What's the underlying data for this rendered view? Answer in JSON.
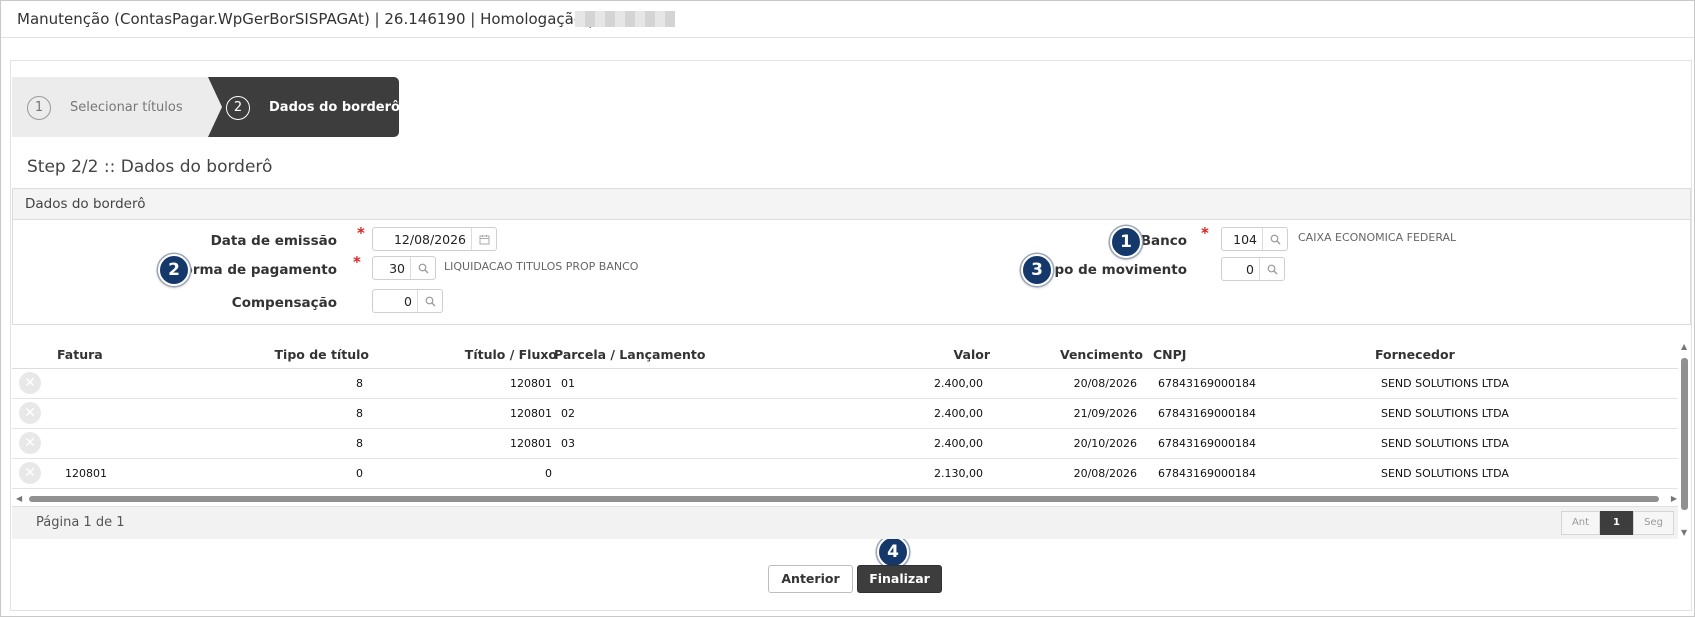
{
  "window": {
    "title": "Manutenção (ContasPagar.WpGerBorSISPAGAt) | 26.146190 | Homologação |"
  },
  "wizard": {
    "steps": [
      {
        "number": "1",
        "label": "Selecionar títulos"
      },
      {
        "number": "2",
        "label": "Dados do borderô"
      }
    ]
  },
  "page": {
    "heading": "Step 2/2 :: Dados do borderô"
  },
  "form": {
    "section_title": "Dados do borderô",
    "required_mark": "*",
    "data_emissao": {
      "label": "Data de emissão",
      "value": "12/08/2026",
      "icon": "calendar-icon"
    },
    "forma_pagamento": {
      "label": "Forma de pagamento",
      "value": "30",
      "description": "LIQUIDACAO TITULOS PROP BANCO",
      "icon": "search-icon"
    },
    "compensacao": {
      "label": "Compensação",
      "value": "0",
      "icon": "search-icon"
    },
    "banco": {
      "label": "Banco",
      "value": "104",
      "description": "CAIXA ECONOMICA FEDERAL",
      "icon": "search-icon"
    },
    "tipo_movimento": {
      "label": "Tipo de movimento",
      "value": "0",
      "icon": "search-icon"
    }
  },
  "callouts": [
    "1",
    "2",
    "3",
    "4"
  ],
  "grid": {
    "columns": [
      "Fatura",
      "Tipo de título",
      "Título / Fluxo",
      "Parcela / Lançamento",
      "Valor",
      "Vencimento",
      "CNPJ",
      "Fornecedor"
    ],
    "rows": [
      {
        "fatura": "",
        "tipo": "8",
        "titulo": "120801",
        "parcela": "01",
        "valor": "2.400,00",
        "vencimento": "20/08/2026",
        "cnpj": "67843169000184",
        "fornecedor": "SEND SOLUTIONS LTDA"
      },
      {
        "fatura": "",
        "tipo": "8",
        "titulo": "120801",
        "parcela": "02",
        "valor": "2.400,00",
        "vencimento": "21/09/2026",
        "cnpj": "67843169000184",
        "fornecedor": "SEND SOLUTIONS LTDA"
      },
      {
        "fatura": "",
        "tipo": "8",
        "titulo": "120801",
        "parcela": "03",
        "valor": "2.400,00",
        "vencimento": "20/10/2026",
        "cnpj": "67843169000184",
        "fornecedor": "SEND SOLUTIONS LTDA"
      },
      {
        "fatura": "120801",
        "tipo": "0",
        "titulo": "0",
        "parcela": "",
        "valor": "2.130,00",
        "vencimento": "20/08/2026",
        "cnpj": "67843169000184",
        "fornecedor": "SEND SOLUTIONS LTDA"
      }
    ]
  },
  "pager": {
    "info": "Página 1 de 1",
    "prev": "Ant",
    "current": "1",
    "next": "Seg"
  },
  "actions": {
    "previous": "Anterior",
    "finish": "Finalizar"
  },
  "colors": {
    "accent_dark": "#3d3d3d",
    "callout": "#15386b",
    "required": "#dd2222"
  }
}
